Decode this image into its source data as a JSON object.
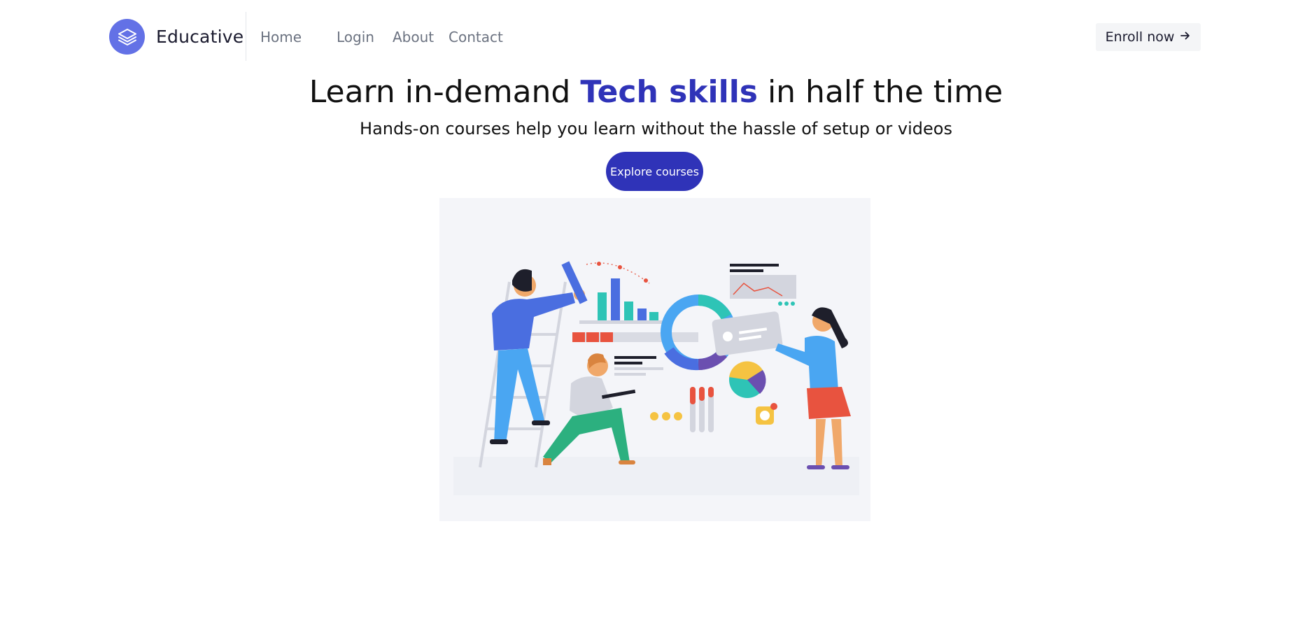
{
  "brand": {
    "name": "Educative",
    "logo_icon": "layers-icon",
    "logo_color": "#6371e6"
  },
  "nav": {
    "links": [
      {
        "label": "Home"
      },
      {
        "label": "Login"
      },
      {
        "label": "About"
      },
      {
        "label": "Contact"
      }
    ],
    "cta_label": "Enroll now",
    "cta_icon": "arrow-right-icon"
  },
  "hero": {
    "title_before": "Learn in-demand ",
    "title_highlight": "Tech skills",
    "title_after": " in half the time",
    "subtitle": "Hands-on courses help you learn without the hassle of setup or videos",
    "button_label": "Explore courses",
    "accent_color": "#2f33b8",
    "illustration": "team-analytics-illustration"
  }
}
